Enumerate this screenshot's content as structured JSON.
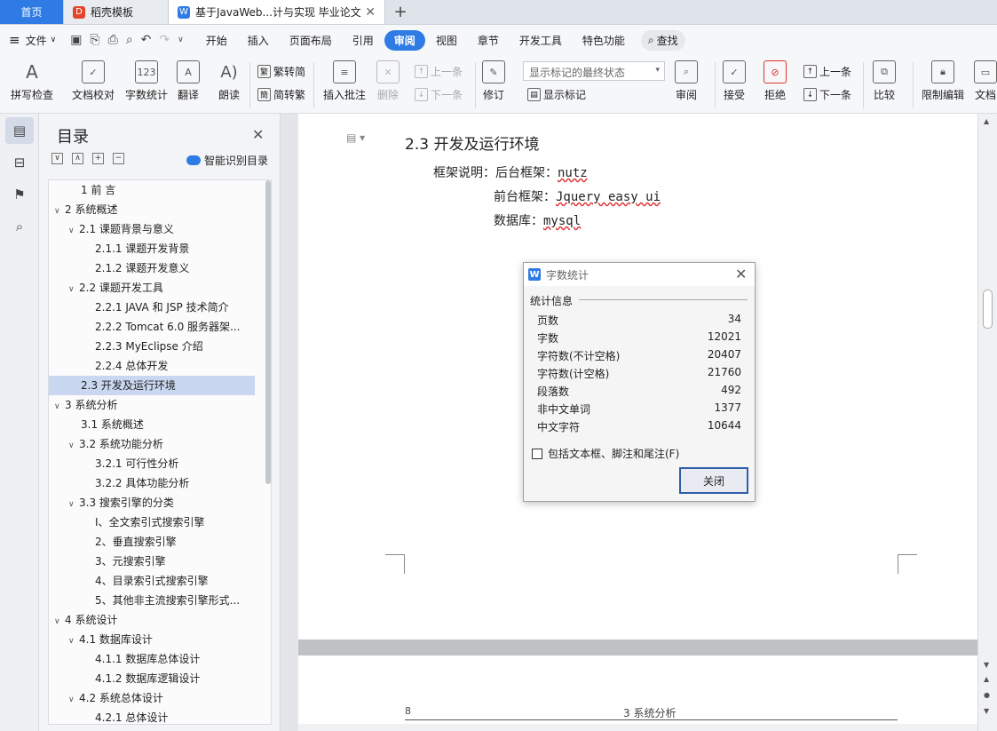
{
  "tabs": [
    {
      "label": "首页"
    },
    {
      "label": "稻壳模板",
      "icon": "wps-template-icon"
    },
    {
      "label": "基于JavaWeb...计与实现 毕业论文",
      "icon": "writer-doc-icon"
    }
  ],
  "menubar": {
    "file": "文件",
    "items": [
      "开始",
      "插入",
      "页面布局",
      "引用",
      "审阅",
      "视图",
      "章节",
      "开发工具",
      "特色功能"
    ],
    "active": "审阅",
    "search": "查找"
  },
  "ribbon": {
    "spell_check": "拼写检查",
    "doc_proof": "文档校对",
    "word_count": "字数统计",
    "translate": "翻译",
    "read_aloud": "朗读",
    "trad_conv": "繁转简",
    "simp_conv": "简转繁",
    "insert_comment": "插入批注",
    "delete": "删除",
    "prev_comment": "上一条",
    "next_comment": "下一条",
    "revise": "修订",
    "markup_state": "显示标记的最终状态",
    "show_markup": "显示标记",
    "review": "审阅",
    "accept": "接受",
    "reject": "拒绝",
    "prev_change": "上一条",
    "next_change": "下一条",
    "compare": "比较",
    "restrict_edit": "限制编辑",
    "doc_more": "文档"
  },
  "toc": {
    "title": "目录",
    "smart": "智能识别目录",
    "items": [
      {
        "text": "1 前 言",
        "level": 1,
        "chev": false
      },
      {
        "text": "2 系统概述",
        "level": 0,
        "chev": true
      },
      {
        "text": "2.1  课题背景与意义",
        "level": 1,
        "chev": true
      },
      {
        "text": "2.1.1 课题开发背景",
        "level": 2,
        "chev": false
      },
      {
        "text": "2.1.2 课题开发意义",
        "level": 2,
        "chev": false
      },
      {
        "text": "2.2 课题开发工具",
        "level": 1,
        "chev": true
      },
      {
        "text": "2.2.1 JAVA 和 JSP 技术简介",
        "level": 2,
        "chev": false
      },
      {
        "text": "2.2.2 Tomcat 6.0 服务器架...",
        "level": 2,
        "chev": false
      },
      {
        "text": "2.2.3 MyEclipse 介绍",
        "level": 2,
        "chev": false
      },
      {
        "text": "2.2.4 总体开发",
        "level": 2,
        "chev": false
      },
      {
        "text": "2.3  开发及运行环境",
        "level": 1,
        "chev": false,
        "selected": true
      },
      {
        "text": "3  系统分析",
        "level": 0,
        "chev": true
      },
      {
        "text": "3.1    系统概述",
        "level": 1,
        "chev": false
      },
      {
        "text": "3.2  系统功能分析",
        "level": 1,
        "chev": true
      },
      {
        "text": "3.2.1  可行性分析",
        "level": 2,
        "chev": false
      },
      {
        "text": "3.2.2  具体功能分析",
        "level": 2,
        "chev": false
      },
      {
        "text": "3.3 搜索引擎的分类",
        "level": 1,
        "chev": true
      },
      {
        "text": "Ⅰ、全文索引式搜索引擎",
        "level": 2,
        "chev": false
      },
      {
        "text": "2、垂直搜索引擎",
        "level": 2,
        "chev": false
      },
      {
        "text": "3、元搜索引擎",
        "level": 2,
        "chev": false
      },
      {
        "text": "4、目录索引式搜索引擎",
        "level": 2,
        "chev": false
      },
      {
        "text": "5、其他非主流搜索引擎形式...",
        "level": 2,
        "chev": false
      },
      {
        "text": "4  系统设计",
        "level": 0,
        "chev": true
      },
      {
        "text": "4.1  数据库设计",
        "level": 1,
        "chev": true
      },
      {
        "text": "4.1.1  数据库总体设计",
        "level": 2,
        "chev": false
      },
      {
        "text": "4.1.2  数据库逻辑设计",
        "level": 2,
        "chev": false
      },
      {
        "text": "4.2  系统总体设计",
        "level": 1,
        "chev": true
      },
      {
        "text": "4.2.1  总体设计",
        "level": 2,
        "chev": false
      }
    ]
  },
  "document": {
    "heading": "2.3  开发及运行环境",
    "line1_prefix": "框架说明：后台框架：",
    "line1_value": "nutz",
    "line2_prefix": "前台框架：",
    "line2_value": "Jquery easy ui",
    "line3_prefix": "数据库：",
    "line3_value": "mysql",
    "footer_page": "8",
    "footer_chapter": "3  系统分析"
  },
  "dialog": {
    "title": "字数统计",
    "group": "统计信息",
    "rows": [
      {
        "label": "页数",
        "value": "34"
      },
      {
        "label": "字数",
        "value": "12021"
      },
      {
        "label": "字符数(不计空格)",
        "value": "20407"
      },
      {
        "label": "字符数(计空格)",
        "value": "21760"
      },
      {
        "label": "段落数",
        "value": "492"
      },
      {
        "label": "非中文单词",
        "value": "1377"
      },
      {
        "label": "中文字符",
        "value": "10644"
      }
    ],
    "checkbox": "包括文本框、脚注和尾注(F)",
    "close": "关闭"
  },
  "colors": {
    "accent": "#2f7be5",
    "selection": "#c9d7f0",
    "squiggle": "#e03030"
  }
}
